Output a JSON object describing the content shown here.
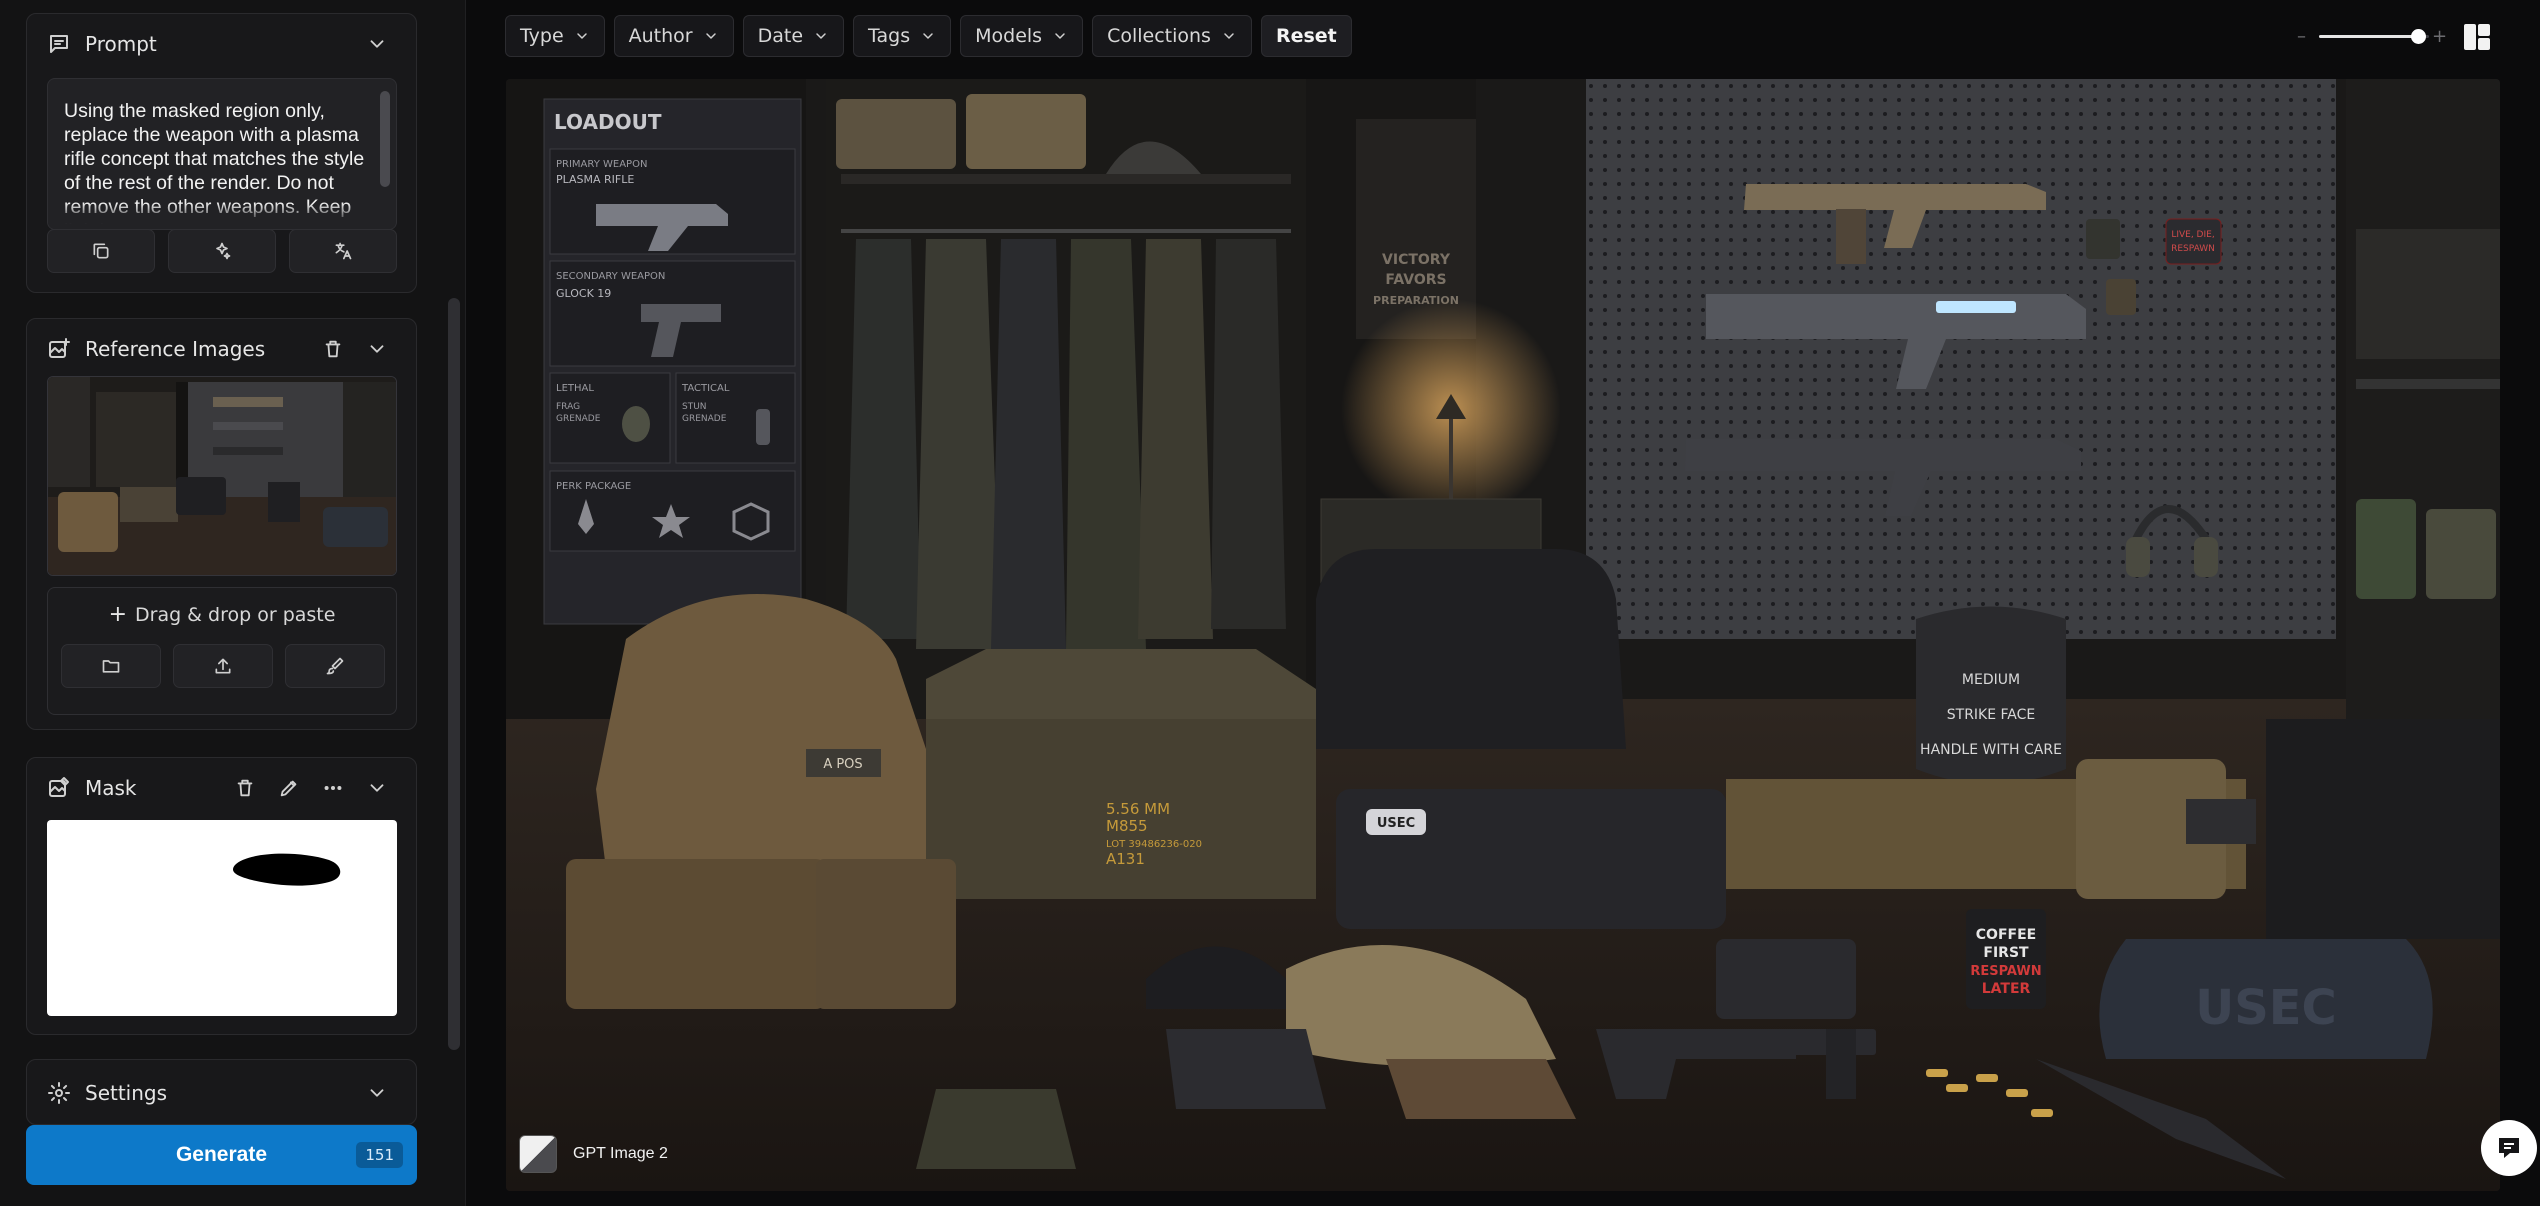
{
  "sidebar": {
    "prompt": {
      "title": "Prompt",
      "text": "Using the masked region only, replace the weapon with a plasma rifle concept that matches the style of the rest of the render. Do not remove the other weapons. Keep lighting",
      "tools": [
        "copy-icon",
        "enhance-icon",
        "translate-icon"
      ]
    },
    "reference": {
      "title": "Reference Images",
      "drop_label": "Drag & drop or paste",
      "actions": [
        "folder-icon",
        "upload-icon",
        "brush-icon"
      ]
    },
    "mask": {
      "title": "Mask"
    },
    "settings": {
      "title": "Settings"
    },
    "generate": {
      "label": "Generate",
      "credits": "151"
    }
  },
  "toolbar": {
    "filters": [
      "Type",
      "Author",
      "Date",
      "Tags",
      "Models",
      "Collections"
    ],
    "reset_label": "Reset",
    "zoom_minus": "–",
    "zoom_plus": "+",
    "zoom_level": 0.9
  },
  "canvas": {
    "model_label": "GPT Image 2",
    "loadout": {
      "title": "LOADOUT",
      "primary_label": "PRIMARY WEAPON",
      "primary_name": "PLASMA RIFLE",
      "secondary_label": "SECONDARY WEAPON",
      "secondary_name": "GLOCK 19",
      "lethal_label": "LETHAL",
      "lethal_name_1": "FRAG",
      "lethal_name_2": "GRENADE",
      "tactical_label": "TACTICAL",
      "tactical_name_1": "STUN",
      "tactical_name_2": "GRENADE",
      "perk_label": "PERK PACKAGE"
    },
    "poster": [
      "VICTORY",
      "FAVORS",
      "PREPARATION"
    ],
    "plate": [
      "MEDIUM",
      "STRIKE FACE",
      "HANDLE WITH CARE"
    ],
    "crate": [
      "5.56 MM",
      "M855",
      "LOT 39486236-020",
      "A131"
    ],
    "mug": [
      "COFFEE",
      "FIRST",
      "RESPAWN",
      "LATER"
    ],
    "bag_text": "USEC",
    "patch": [
      "LIVE, DIE,",
      "RESPAWN"
    ],
    "vest_patch": "A POS",
    "case_patch": "USEC"
  },
  "colors": {
    "accent": "#0d79c9",
    "panel": "#18181a",
    "background": "#0b0b0c"
  }
}
